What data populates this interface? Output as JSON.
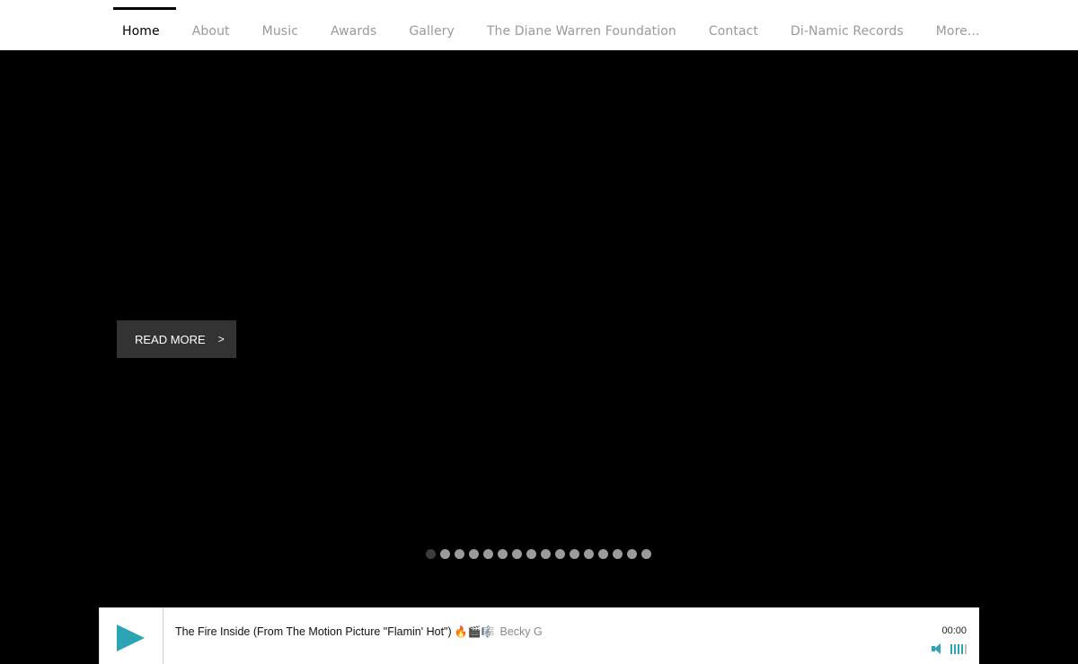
{
  "nav": {
    "items": [
      {
        "label": "Home",
        "active": true
      },
      {
        "label": "About"
      },
      {
        "label": "Music"
      },
      {
        "label": "Awards"
      },
      {
        "label": "Gallery"
      },
      {
        "label": "The Diane Warren Foundation"
      },
      {
        "label": "Contact"
      },
      {
        "label": "Di-Namic Records"
      },
      {
        "label": "More..."
      }
    ]
  },
  "hero": {
    "read_more_label": "READ MORE",
    "read_more_arrow": ">",
    "slides": {
      "count": 16,
      "active_index": 0
    }
  },
  "player": {
    "track_title": "The Fire Inside (From The Motion Picture \"Flamin' Hot\")",
    "track_emoji": "🔥🎬🎼",
    "artist": "Becky G",
    "time": "00:00",
    "volume_level": 0.8,
    "accent_color": "#2ba4b3",
    "play_icon": "play-icon",
    "volume_icon": "speaker-icon"
  }
}
